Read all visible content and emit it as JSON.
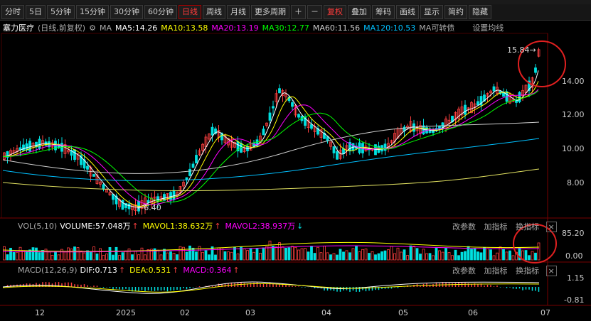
{
  "toolbar": {
    "periods": [
      "分时",
      "5日",
      "5分钟",
      "15分钟",
      "30分钟",
      "60分钟",
      "日线",
      "周线",
      "月线",
      "更多周期"
    ],
    "active_period": "日线",
    "fq": "复权",
    "overlay": "叠加",
    "chips": "筹码",
    "draw": "画线",
    "display": "显示",
    "simple": "简约",
    "hide": "隐藏"
  },
  "info": {
    "stock_name": "塞力医疗",
    "mode": "(日线,前复权)",
    "ma_prefix": "MA",
    "ma5": "MA5:14.26",
    "ma10": "MA10:13.58",
    "ma20": "MA20:13.19",
    "ma30": "MA30:12.77",
    "ma60": "MA60:11.56",
    "ma120": "MA120:10.53",
    "bond": "MA可转债",
    "settings": "设置均线"
  },
  "price_axis": [
    "14.00",
    "12.00",
    "10.00",
    "8.00"
  ],
  "annotations": {
    "high": "15.84",
    "low": "6.40"
  },
  "volume": {
    "title": "VOL(5,10)",
    "volume": "VOLUME:57.048万",
    "mavol1": "MAVOL1:38.632万",
    "mavol2": "MAVOL2:38.937万",
    "axis": [
      "85.20",
      "0.00"
    ]
  },
  "macd": {
    "title": "MACD(12,26,9)",
    "dif": "DIF:0.713",
    "dea": "DEA:0.531",
    "macd": "MACD:0.364",
    "axis": [
      "1.15",
      "-0.81"
    ]
  },
  "panel_links": [
    "改参数",
    "加指标",
    "换指标"
  ],
  "dates": [
    "12",
    "2025",
    "02",
    "03",
    "04",
    "05",
    "06",
    "07"
  ],
  "colors": {
    "up": "#ff4040",
    "down": "#00e0e0",
    "ma5": "#ffffff",
    "ma10": "#ffff00",
    "ma20": "#ff00ff",
    "ma30": "#00ff00",
    "ma60": "#cccccc",
    "ma120": "#00c0ff",
    "ma250": "#e0e060",
    "highlight": "#e02020"
  }
}
